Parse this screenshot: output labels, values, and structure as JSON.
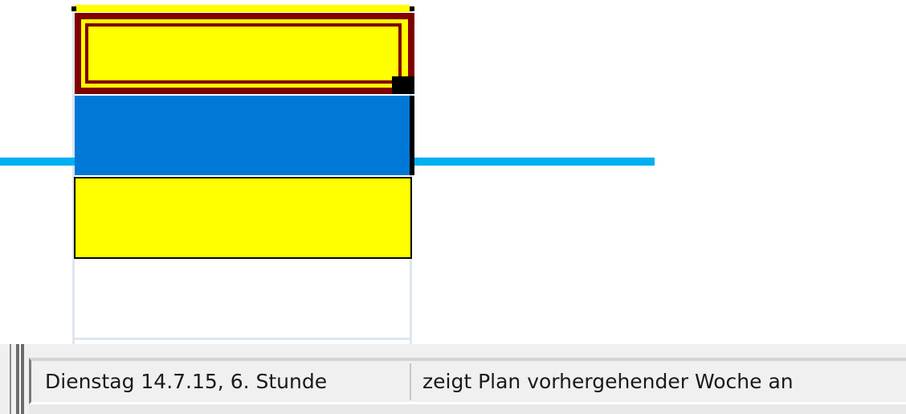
{
  "status_bar": {
    "panel_1": "Dienstag 14.7.15, 6. Stunde",
    "panel_2": "zeigt Plan vorhergehender Woche an"
  },
  "colors": {
    "lesson_yellow": "#ffff00",
    "lesson_blue": "#0078d7",
    "selection_border": "#800000",
    "current_time_line": "#00b0f0",
    "grid": "#dde6ee"
  }
}
